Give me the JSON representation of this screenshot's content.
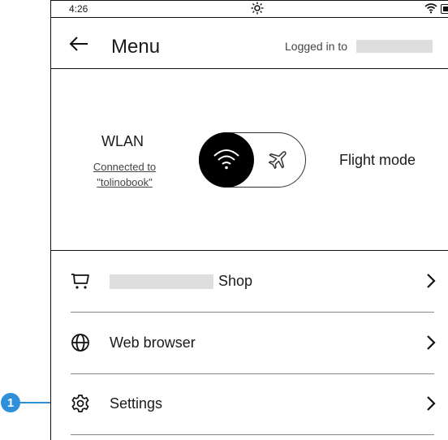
{
  "status_bar": {
    "time": "4:26"
  },
  "header": {
    "title": "Menu",
    "logged_in_label": "Logged in to"
  },
  "wlan": {
    "label": "WLAN",
    "connected_line1": "Connected to",
    "connected_line2": "\"tolinobook\"",
    "flight_mode_label": "Flight mode",
    "wlan_enabled": true
  },
  "menu": {
    "items": [
      {
        "label": "Shop",
        "icon": "shopping-cart-icon"
      },
      {
        "label": "Web browser",
        "icon": "globe-icon"
      },
      {
        "label": "Settings",
        "icon": "gear-icon"
      }
    ]
  },
  "callout": {
    "number": "1"
  },
  "colors": {
    "knob": "#000000",
    "redacted": "#dedede",
    "callout": "#2f8fd8"
  }
}
